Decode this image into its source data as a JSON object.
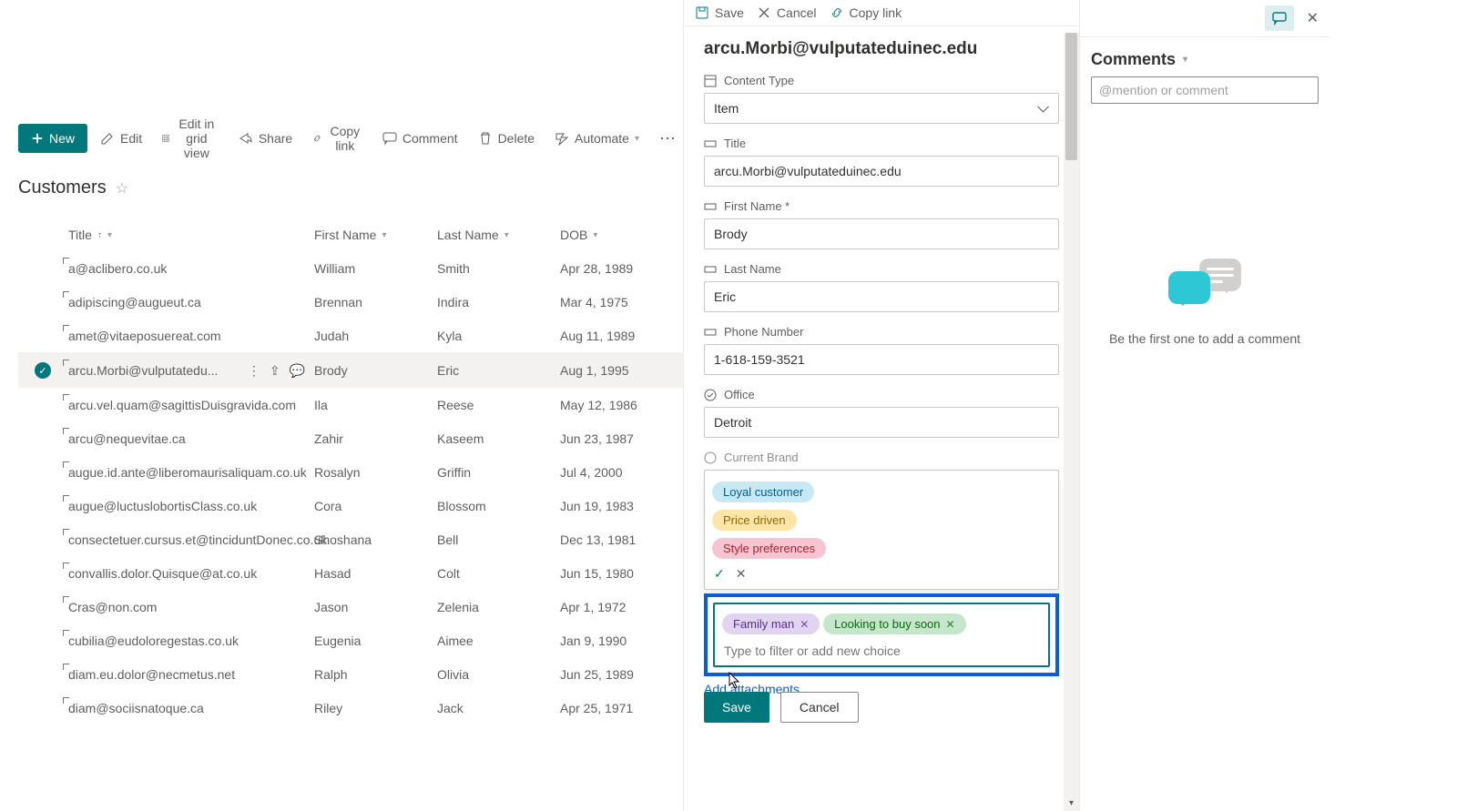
{
  "toolbar": {
    "new": "New",
    "edit": "Edit",
    "edit_grid": "Edit in grid view",
    "share": "Share",
    "copy_link": "Copy link",
    "comment": "Comment",
    "delete": "Delete",
    "automate": "Automate"
  },
  "list": {
    "title": "Customers",
    "columns": {
      "title": "Title",
      "first_name": "First Name",
      "last_name": "Last Name",
      "dob": "DOB"
    },
    "rows": [
      {
        "title": "a@aclibero.co.uk",
        "fn": "William",
        "ln": "Smith",
        "dob": "Apr 28, 1989"
      },
      {
        "title": "adipiscing@augueut.ca",
        "fn": "Brennan",
        "ln": "Indira",
        "dob": "Mar 4, 1975"
      },
      {
        "title": "amet@vitaeposuereat.com",
        "fn": "Judah",
        "ln": "Kyla",
        "dob": "Aug 11, 1989"
      },
      {
        "title": "arcu.Morbi@vulputatedu...",
        "fn": "Brody",
        "ln": "Eric",
        "dob": "Aug 1, 1995",
        "selected": true
      },
      {
        "title": "arcu.vel.quam@sagittisDuisgravida.com",
        "fn": "Ila",
        "ln": "Reese",
        "dob": "May 12, 1986"
      },
      {
        "title": "arcu@nequevitae.ca",
        "fn": "Zahir",
        "ln": "Kaseem",
        "dob": "Jun 23, 1987"
      },
      {
        "title": "augue.id.ante@liberomaurisaliquam.co.uk",
        "fn": "Rosalyn",
        "ln": "Griffin",
        "dob": "Jul 4, 2000"
      },
      {
        "title": "augue@luctuslobortisClass.co.uk",
        "fn": "Cora",
        "ln": "Blossom",
        "dob": "Jun 19, 1983"
      },
      {
        "title": "consectetuer.cursus.et@tinciduntDonec.co.uk",
        "fn": "Shoshana",
        "ln": "Bell",
        "dob": "Dec 13, 1981"
      },
      {
        "title": "convallis.dolor.Quisque@at.co.uk",
        "fn": "Hasad",
        "ln": "Colt",
        "dob": "Jun 15, 1980"
      },
      {
        "title": "Cras@non.com",
        "fn": "Jason",
        "ln": "Zelenia",
        "dob": "Apr 1, 1972"
      },
      {
        "title": "cubilia@eudoloregestas.co.uk",
        "fn": "Eugenia",
        "ln": "Aimee",
        "dob": "Jan 9, 1990"
      },
      {
        "title": "diam.eu.dolor@necmetus.net",
        "fn": "Ralph",
        "ln": "Olivia",
        "dob": "Jun 25, 1989"
      },
      {
        "title": "diam@sociisnatoque.ca",
        "fn": "Riley",
        "ln": "Jack",
        "dob": "Apr 25, 1971"
      }
    ]
  },
  "panel": {
    "save": "Save",
    "cancel": "Cancel",
    "copy_link": "Copy link",
    "title": "arcu.Morbi@vulputateduinec.edu",
    "labels": {
      "content_type": "Content Type",
      "title_field": "Title",
      "first_name": "First Name *",
      "last_name": "Last Name",
      "phone": "Phone Number",
      "office": "Office",
      "current_brand": "Current Brand"
    },
    "values": {
      "content_type": "Item",
      "title_field": "arcu.Morbi@vulputateduinec.edu",
      "first_name": "Brody",
      "last_name": "Eric",
      "phone": "1-618-159-3521",
      "office": "Detroit"
    },
    "dropdown_options": [
      "Loyal customer",
      "Price driven",
      "Style preferences"
    ],
    "selected_tags": [
      "Family man",
      "Looking to buy soon"
    ],
    "filter_placeholder": "Type to filter or add new choice",
    "add_attachments": "Add attachments",
    "footer_save": "Save",
    "footer_cancel": "Cancel"
  },
  "comments": {
    "title": "Comments",
    "placeholder": "@mention or comment",
    "empty": "Be the first one to add a comment"
  }
}
